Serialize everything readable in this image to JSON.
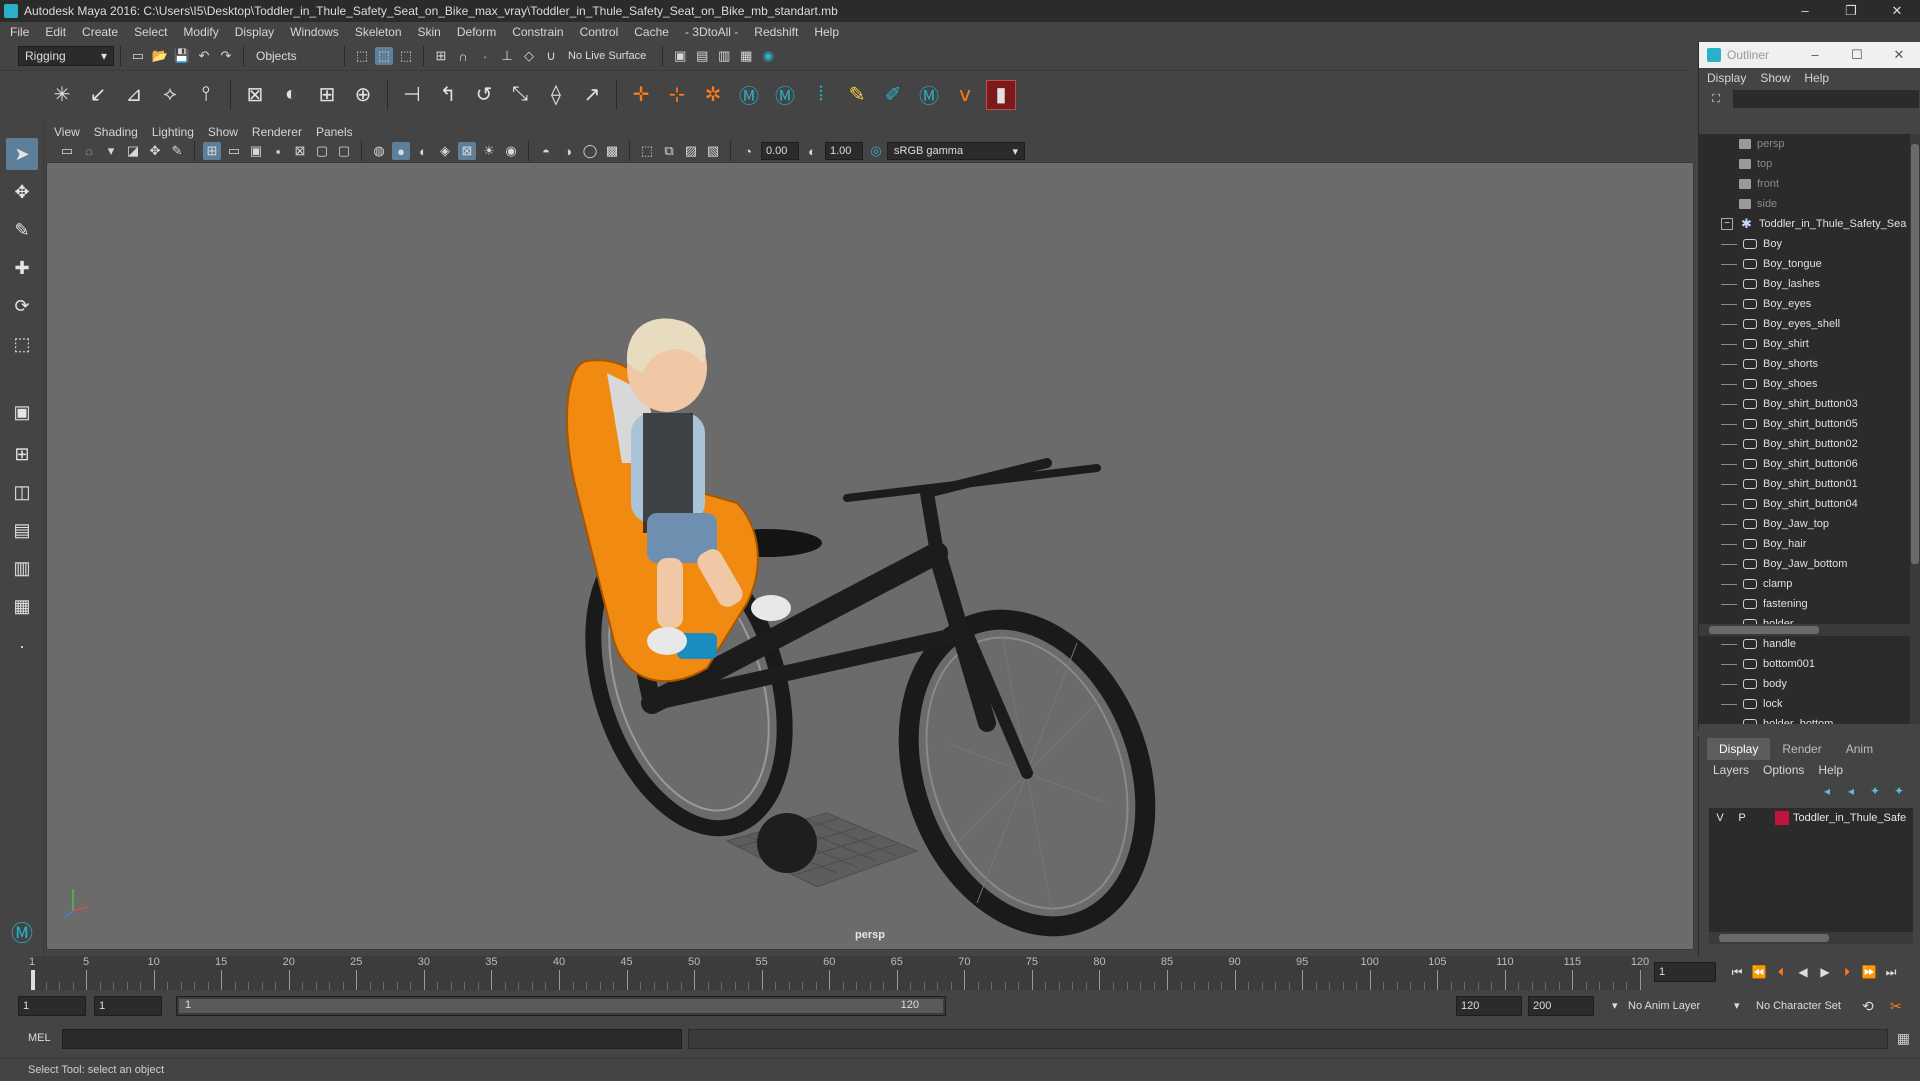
{
  "window": {
    "title": "Autodesk Maya 2016: C:\\Users\\I5\\Desktop\\Toddler_in_Thule_Safety_Seat_on_Bike_max_vray\\Toddler_in_Thule_Safety_Seat_on_Bike_mb_standart.mb",
    "minimize": "–",
    "maximize": "❐",
    "close": "✕"
  },
  "menubar": [
    "File",
    "Edit",
    "Create",
    "Select",
    "Modify",
    "Display",
    "Windows",
    "Skeleton",
    "Skin",
    "Deform",
    "Constrain",
    "Control",
    "Cache",
    "- 3DtoAll -",
    "Redshift",
    "Help"
  ],
  "statusline": {
    "mode": "Rigging",
    "selection_mode": "Objects",
    "live_surface": "No Live Surface"
  },
  "panel": {
    "menu": [
      "View",
      "Shading",
      "Lighting",
      "Show",
      "Renderer",
      "Panels"
    ],
    "near_value": "0.00",
    "far_value": "1.00",
    "color_space": "sRGB gamma",
    "camera": "persp"
  },
  "outliner": {
    "title": "Outliner",
    "menu": [
      "Display",
      "Show",
      "Help"
    ],
    "cameras": [
      "persp",
      "top",
      "front",
      "side"
    ],
    "group": "Toddler_in_Thule_Safety_Sea",
    "children": [
      "Boy",
      "Boy_tongue",
      "Boy_lashes",
      "Boy_eyes",
      "Boy_eyes_shell",
      "Boy_shirt",
      "Boy_shorts",
      "Boy_shoes",
      "Boy_shirt_button03",
      "Boy_shirt_button05",
      "Boy_shirt_button02",
      "Boy_shirt_button06",
      "Boy_shirt_button01",
      "Boy_shirt_button04",
      "Boy_Jaw_top",
      "Boy_hair",
      "Boy_Jaw_bottom",
      "clamp",
      "fastening",
      "holder",
      "handle",
      "bottom001",
      "body",
      "lock",
      "holder_bottom"
    ]
  },
  "layers": {
    "tabs": [
      "Display",
      "Render",
      "Anim"
    ],
    "active_tab": "Display",
    "menu": [
      "Layers",
      "Options",
      "Help"
    ],
    "row": {
      "v": "V",
      "p": "P",
      "name": "Toddler_in_Thule_Safe",
      "color": "#c2143c"
    }
  },
  "timeline": {
    "tick_labels": [
      "1",
      "5",
      "10",
      "15",
      "20",
      "25",
      "30",
      "35",
      "40",
      "45",
      "50",
      "55",
      "60",
      "65",
      "70",
      "75",
      "80",
      "85",
      "90",
      "95",
      "100",
      "105",
      "110",
      "115",
      "120"
    ],
    "current_frame": "1"
  },
  "range": {
    "start": "1",
    "playback_start": "1",
    "slider_start": "1",
    "slider_end": "120",
    "playback_end": "120",
    "end": "200",
    "anim_layer": "No Anim Layer",
    "character_set": "No Character Set"
  },
  "cmdline": {
    "label": "MEL"
  },
  "helpline": "Select Tool: select an object"
}
